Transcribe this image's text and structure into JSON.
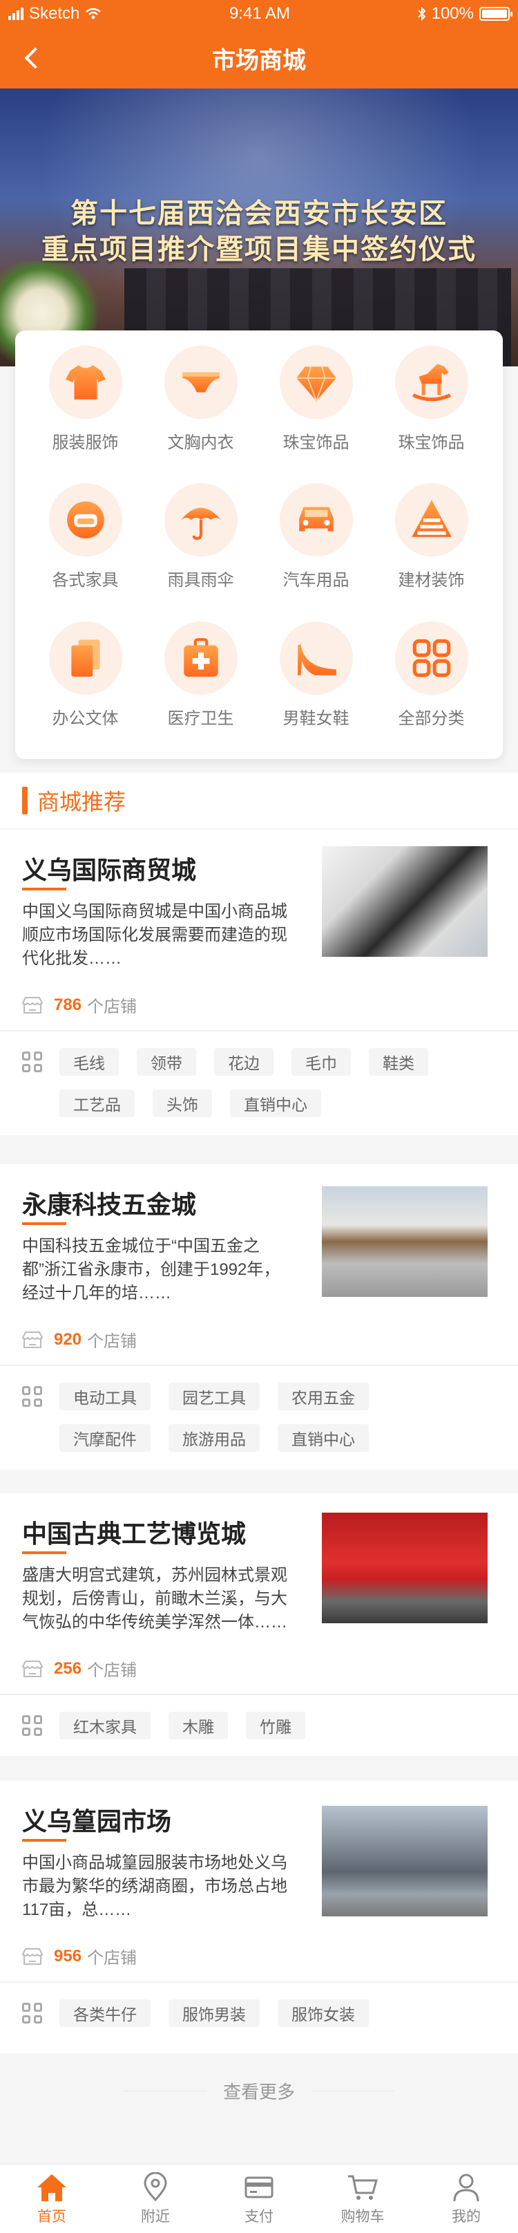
{
  "status_bar": {
    "carrier": "Sketch",
    "time": "9:41 AM",
    "battery": "100%"
  },
  "navbar": {
    "title": "市场商城"
  },
  "banner": {
    "line1": "第十七届西洽会西安市长安区",
    "line2": "重点项目推介暨项目集中签约仪式"
  },
  "categories": [
    {
      "label": "服装服饰",
      "icon": "tshirt-icon"
    },
    {
      "label": "文胸内衣",
      "icon": "underwear-icon"
    },
    {
      "label": "珠宝饰品",
      "icon": "diamond-icon"
    },
    {
      "label": "珠宝饰品",
      "icon": "rocking-horse-icon"
    },
    {
      "label": "各式家具",
      "icon": "sofa-icon"
    },
    {
      "label": "雨具雨伞",
      "icon": "umbrella-icon"
    },
    {
      "label": "汽车用品",
      "icon": "car-icon"
    },
    {
      "label": "建材装饰",
      "icon": "building-materials-icon"
    },
    {
      "label": "办公文体",
      "icon": "documents-icon"
    },
    {
      "label": "医疗卫生",
      "icon": "medical-kit-icon"
    },
    {
      "label": "男鞋女鞋",
      "icon": "high-heel-icon"
    },
    {
      "label": "全部分类",
      "icon": "all-categories-icon"
    }
  ],
  "section": {
    "title": "商城推荐"
  },
  "markets": [
    {
      "name": "义乌国际商贸城",
      "desc": "中国义乌国际商贸城是中国小商品城顺应市场国际化发展需要而建造的现代化批发……",
      "stores": "786",
      "stores_suffix": "个店铺",
      "tags_row1": [
        "毛线",
        "领带",
        "花边",
        "毛巾",
        "鞋类"
      ],
      "tags_row2": [
        "工艺品",
        "头饰",
        "直销中心"
      ]
    },
    {
      "name": "永康科技五金城",
      "desc": "中国科技五金城位于“中国五金之都”浙江省永康市，创建于1992年，经过十几年的培……",
      "stores": "920",
      "stores_suffix": "个店铺",
      "tags_row1": [
        "电动工具",
        "园艺工具",
        "农用五金"
      ],
      "tags_row2": [
        "汽摩配件",
        "旅游用品",
        "直销中心"
      ]
    },
    {
      "name": "中国古典工艺博览城",
      "desc": "盛唐大明宫式建筑，苏州园林式景观规划，后傍青山，前瞰木兰溪，与大气恢弘的中华传统美学浑然一体……",
      "stores": "256",
      "stores_suffix": "个店铺",
      "tags_row1": [
        "红木家具",
        "木雕",
        "竹雕"
      ],
      "tags_row2": []
    },
    {
      "name": "义乌篁园市场",
      "desc": "中国小商品城篁园服装市场地处义乌市最为繁华的绣湖商圈，市场总占地117亩，总……",
      "stores": "956",
      "stores_suffix": "个店铺",
      "tags_row1": [
        "各类牛仔",
        "服饰男装",
        "服饰女装"
      ],
      "tags_row2": []
    }
  ],
  "more": {
    "label": "查看更多"
  },
  "tabbar": [
    {
      "label": "首页",
      "icon": "home-icon",
      "active": true
    },
    {
      "label": "附近",
      "icon": "location-pin-icon",
      "active": false
    },
    {
      "label": "支付",
      "icon": "card-icon",
      "active": false
    },
    {
      "label": "购物车",
      "icon": "cart-icon",
      "active": false
    },
    {
      "label": "我的",
      "icon": "user-icon",
      "active": false
    }
  ],
  "colors": {
    "accent": "#f56e1a",
    "icon_bg": "#fdeee6",
    "page_bg": "#f5f5f5"
  }
}
